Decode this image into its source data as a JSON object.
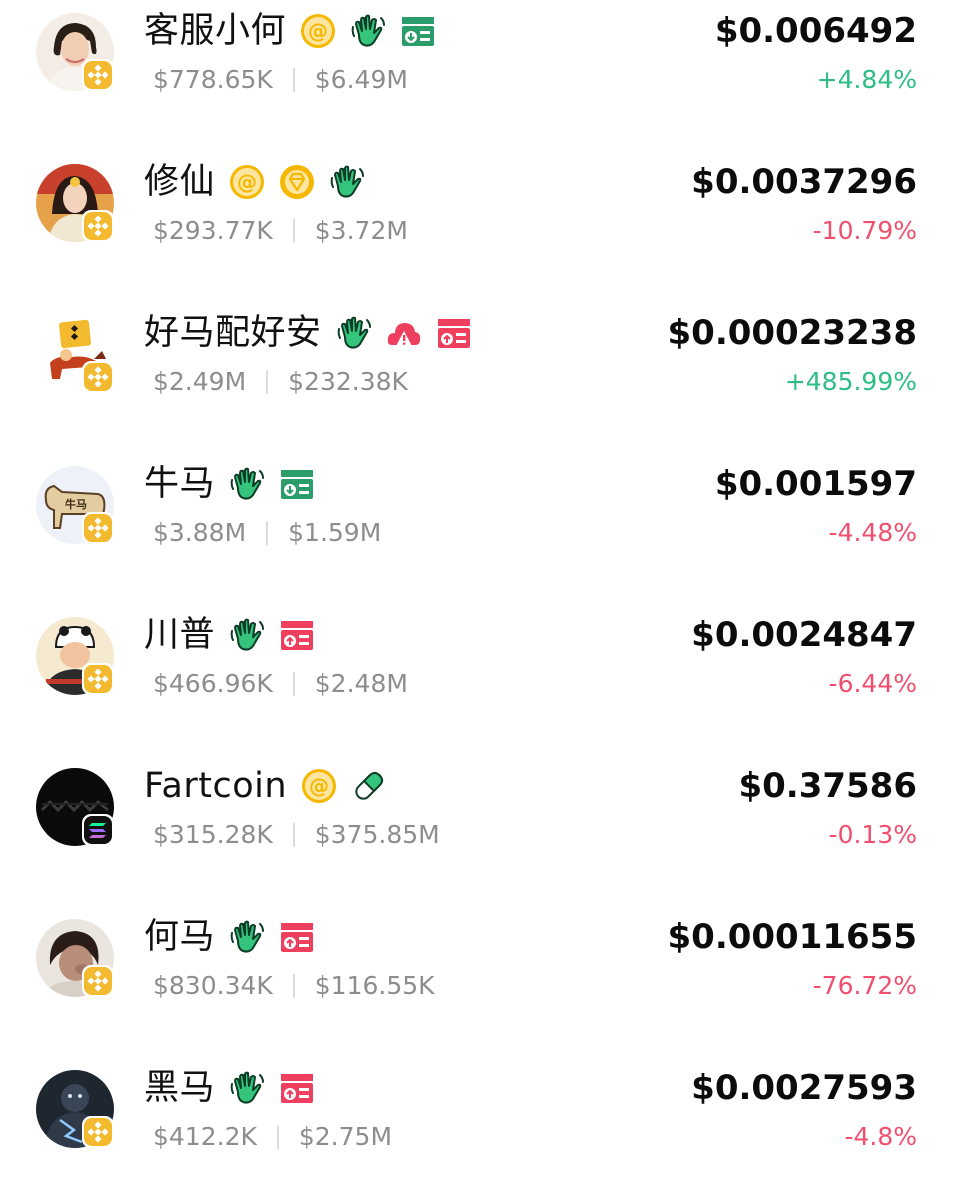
{
  "colors": {
    "positive": "#2ebd85",
    "negative": "#f0506e",
    "mention": "#f5b700",
    "hand": "#2ebd85",
    "tag_green": "#2a9d6a",
    "tag_red": "#ee3f5e"
  },
  "tokens": [
    {
      "name": "客服小何",
      "chain": "bnb-chain-icon",
      "icons": [
        "at-mention-icon",
        "waving-hand-icon",
        "green-tag-icon"
      ],
      "volume": "$778.65K",
      "market_cap": "$6.49M",
      "price": "$0.006492",
      "change": "+4.84%",
      "direction": "up"
    },
    {
      "name": "修仙",
      "chain": "bnb-chain-icon",
      "icons": [
        "at-mention-icon",
        "diamond-coin-icon",
        "waving-hand-icon"
      ],
      "volume": "$293.77K",
      "market_cap": "$3.72M",
      "price": "$0.0037296",
      "change": "-10.79%",
      "direction": "down"
    },
    {
      "name": "好马配好安",
      "chain": "bnb-chain-icon",
      "icons": [
        "waving-hand-icon",
        "warning-cloud-icon",
        "red-tag-icon"
      ],
      "volume": "$2.49M",
      "market_cap": "$232.38K",
      "price": "$0.00023238",
      "change": "+485.99%",
      "direction": "up"
    },
    {
      "name": "牛马",
      "chain": "bnb-chain-icon",
      "icons": [
        "waving-hand-icon",
        "green-tag-icon"
      ],
      "volume": "$3.88M",
      "market_cap": "$1.59M",
      "price": "$0.001597",
      "change": "-4.48%",
      "direction": "down"
    },
    {
      "name": "川普",
      "chain": "bnb-chain-icon",
      "icons": [
        "waving-hand-icon",
        "red-tag-icon"
      ],
      "volume": "$466.96K",
      "market_cap": "$2.48M",
      "price": "$0.0024847",
      "change": "-6.44%",
      "direction": "down"
    },
    {
      "name": "Fartcoin",
      "chain": "solana-chain-icon",
      "icons": [
        "at-mention-icon",
        "pill-icon"
      ],
      "volume": "$315.28K",
      "market_cap": "$375.85M",
      "price": "$0.37586",
      "change": "-0.13%",
      "direction": "down"
    },
    {
      "name": "何马",
      "chain": "bnb-chain-icon",
      "icons": [
        "waving-hand-icon",
        "red-tag-icon"
      ],
      "volume": "$830.34K",
      "market_cap": "$116.55K",
      "price": "$0.00011655",
      "change": "-76.72%",
      "direction": "down"
    },
    {
      "name": "黑马",
      "chain": "bnb-chain-icon",
      "icons": [
        "waving-hand-icon",
        "red-tag-icon"
      ],
      "volume": "$412.2K",
      "market_cap": "$2.75M",
      "price": "$0.0027593",
      "change": "-4.8%",
      "direction": "down"
    }
  ]
}
